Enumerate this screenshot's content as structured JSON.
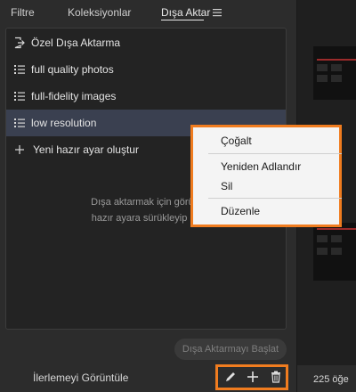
{
  "tabs": [
    {
      "label": "Filtre"
    },
    {
      "label": "Koleksiyonlar"
    },
    {
      "label": "Dışa Aktar"
    }
  ],
  "export_list": {
    "items": [
      {
        "label": "Özel Dışa Aktarma",
        "icon": "custom-export-icon"
      },
      {
        "label": "full quality photos",
        "icon": "list-icon"
      },
      {
        "label": "full-fidelity images",
        "icon": "list-icon"
      },
      {
        "label": "low resolution",
        "icon": "list-icon",
        "selected": true
      },
      {
        "label": "Yeni hazır ayar oluştur",
        "icon": "plus-icon"
      }
    ],
    "hint_line1": "Dışa aktarmak için görünt",
    "hint_line2": "hazır ayara sürükleyip bır"
  },
  "start_button": "Dışa Aktarmayı Başlat",
  "progress_link": "İlerlemeyi Görüntüle",
  "toolbar": {
    "edit_icon": "pencil-icon",
    "add_icon": "plus-icon",
    "delete_icon": "trash-icon"
  },
  "context_menu": {
    "items": [
      {
        "label": "Çoğalt"
      },
      {
        "label": "Yeniden Adlandır"
      },
      {
        "label": "Sil"
      },
      {
        "label": "Düzenle"
      }
    ]
  },
  "grid": {
    "count_label": "225 öğe"
  },
  "colors": {
    "accent_outline": "#f07c1f",
    "selected_row": "#3a4050",
    "panel_bg": "#2c2c2c"
  }
}
